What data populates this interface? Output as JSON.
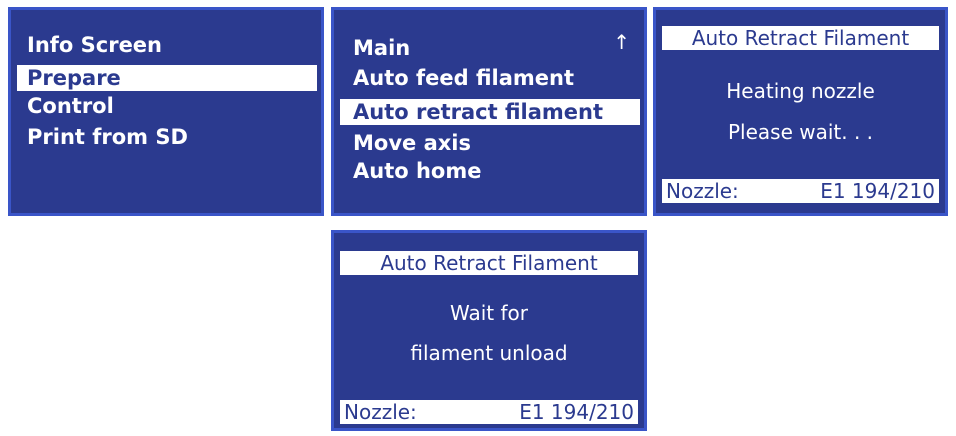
{
  "screen1": {
    "items": [
      {
        "label": "Info Screen"
      },
      {
        "label": "Prepare"
      },
      {
        "label": "Control"
      },
      {
        "label": "Print from SD"
      }
    ]
  },
  "screen2": {
    "items": [
      {
        "label": "Main"
      },
      {
        "label": "Auto feed filament"
      },
      {
        "label": "Auto retract filament"
      },
      {
        "label": "Move axis"
      },
      {
        "label": "Auto home"
      }
    ],
    "scroll_icon": "up-arrow-icon",
    "scroll_glyph": "↑"
  },
  "screen3": {
    "title": "Auto Retract Filament",
    "messages": [
      "Heating nozzle",
      "Please wait. . ."
    ],
    "status_label": "Nozzle:",
    "status_value": "E1 194/210"
  },
  "screen4": {
    "title": "Auto Retract Filament",
    "messages": [
      "Wait for",
      "filament unload"
    ],
    "status_label": "Nozzle:",
    "status_value": "E1 194/210"
  },
  "colors": {
    "screen_bg": "#2b3a8f",
    "screen_border": "#3a55c8",
    "text": "#ffffff",
    "highlight_bg": "#ffffff"
  }
}
